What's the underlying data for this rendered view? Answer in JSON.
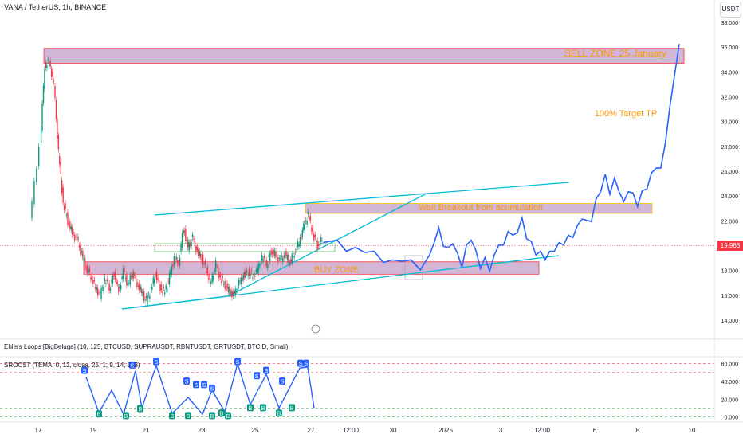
{
  "header": {
    "symbol_title": "VANA / TetherUS, 1h, BINANCE",
    "currency_button": "USDT"
  },
  "indicators": {
    "ehlers_label": "Ehlers Loops [BigBeluga] (10, 125, BTCUSD, SUPRAUSDT, RBNTUSDT, GRTUSDT, BTC.D, Small)",
    "srocst_label": "SROCST (TEMA, 0, 12, close, 25, 1, 9, 14, 1, 3)"
  },
  "current_price": "19.986",
  "colors": {
    "up": "#089981",
    "down": "#f23645",
    "projection": "#2962ff",
    "zone_fill": "#7b2d86",
    "annotation": "#ff9800",
    "trendline": "#00bcd4",
    "price_line": "#f23645"
  },
  "chart_data": [
    {
      "type": "candlestick",
      "title": "VANA / TetherUS, 1h, BINANCE",
      "y_axis_ticks": [
        "14.000",
        "16.000",
        "18.000",
        "20.000",
        "22.000",
        "24.000",
        "26.000",
        "28.000",
        "30.000",
        "32.000",
        "34.000",
        "36.000",
        "38.000"
      ],
      "x_axis_ticks": [
        "17",
        "19",
        "21",
        "23",
        "25",
        "27",
        "12:00",
        "30",
        "2025",
        "3",
        "12:00",
        "6",
        "8",
        "10"
      ],
      "ylim": [
        13.0,
        38.5
      ],
      "price_path": [
        [
          0,
          22.0
        ],
        [
          2,
          28.0
        ],
        [
          3,
          34.5
        ],
        [
          4,
          34.8
        ],
        [
          5,
          33.0
        ],
        [
          6,
          27.5
        ],
        [
          7,
          23.5
        ],
        [
          8,
          22.0
        ],
        [
          9,
          21.0
        ],
        [
          10,
          20.5
        ],
        [
          11,
          19.3
        ],
        [
          12,
          18.2
        ],
        [
          13,
          17.6
        ],
        [
          14,
          16.6
        ],
        [
          15,
          16.0
        ],
        [
          16,
          17.2
        ],
        [
          17,
          16.5
        ],
        [
          18,
          17.8
        ],
        [
          19,
          16.3
        ],
        [
          20,
          17.9
        ],
        [
          21,
          16.8
        ],
        [
          22,
          17.9
        ],
        [
          23,
          17.0
        ],
        [
          24,
          16.2
        ],
        [
          25,
          15.5
        ],
        [
          26,
          16.5
        ],
        [
          27,
          17.8
        ],
        [
          28,
          16.6
        ],
        [
          29,
          16.2
        ],
        [
          30,
          17.5
        ],
        [
          31,
          19.0
        ],
        [
          32,
          18.6
        ],
        [
          33,
          21.5
        ],
        [
          34,
          19.8
        ],
        [
          35,
          20.6
        ],
        [
          36,
          19.5
        ],
        [
          37,
          19.0
        ],
        [
          38,
          18.0
        ],
        [
          39,
          17.0
        ],
        [
          40,
          18.5
        ],
        [
          41,
          17.4
        ],
        [
          42,
          16.8
        ],
        [
          43,
          16.3
        ],
        [
          44,
          16.0
        ],
        [
          45,
          16.9
        ],
        [
          46,
          17.6
        ],
        [
          47,
          17.9
        ],
        [
          48,
          17.6
        ],
        [
          49,
          18.0
        ],
        [
          50,
          19.0
        ],
        [
          51,
          18.5
        ],
        [
          52,
          19.6
        ],
        [
          53,
          19.2
        ],
        [
          54,
          18.8
        ],
        [
          55,
          19.3
        ],
        [
          56,
          18.7
        ],
        [
          57,
          19.5
        ],
        [
          58,
          20.2
        ],
        [
          59,
          21.5
        ],
        [
          60,
          22.5
        ],
        [
          61,
          21.0
        ],
        [
          62,
          20.0
        ],
        [
          63,
          20.5
        ]
      ],
      "projection_path": [
        [
          63,
          20.5
        ],
        [
          66,
          20.2
        ],
        [
          68,
          19.8
        ],
        [
          70,
          19.6
        ],
        [
          72,
          19.7
        ],
        [
          74,
          19.3
        ],
        [
          76,
          18.9
        ],
        [
          78,
          18.6
        ],
        [
          80,
          19.0
        ],
        [
          82,
          18.6
        ],
        [
          84,
          18.3
        ],
        [
          86,
          19.0
        ],
        [
          87,
          20.5
        ],
        [
          88,
          21.2
        ],
        [
          89,
          20.2
        ],
        [
          90,
          19.6
        ],
        [
          91,
          20.4
        ],
        [
          92,
          19.2
        ],
        [
          93,
          18.5
        ],
        [
          94,
          19.8
        ],
        [
          95,
          20.7
        ],
        [
          96,
          19.4
        ],
        [
          97,
          18.4
        ],
        [
          98,
          18.8
        ],
        [
          99,
          18.2
        ],
        [
          100,
          19.0
        ],
        [
          101,
          20.3
        ],
        [
          102,
          19.8
        ],
        [
          103,
          21.4
        ],
        [
          104,
          20.6
        ],
        [
          105,
          21.3
        ],
        [
          106,
          22.0
        ],
        [
          107,
          20.8
        ],
        [
          108,
          20.1
        ],
        [
          109,
          19.5
        ],
        [
          110,
          19.3
        ],
        [
          111,
          19.1
        ],
        [
          112,
          19.3
        ],
        [
          113,
          19.8
        ],
        [
          114,
          20.0
        ],
        [
          115,
          20.3
        ],
        [
          116,
          20.6
        ],
        [
          117,
          20.9
        ],
        [
          118,
          21.4
        ],
        [
          119,
          22.4
        ],
        [
          120,
          21.8
        ],
        [
          121,
          22.2
        ],
        [
          122,
          23.5
        ],
        [
          123,
          24.6
        ],
        [
          124,
          25.5
        ],
        [
          125,
          24.4
        ],
        [
          126,
          25.2
        ],
        [
          127,
          24.6
        ],
        [
          128,
          23.3
        ],
        [
          129,
          24.6
        ],
        [
          130,
          24.0
        ],
        [
          131,
          23.4
        ],
        [
          132,
          24.2
        ],
        [
          133,
          24.8
        ],
        [
          134,
          25.6
        ],
        [
          135,
          26.5
        ],
        [
          136,
          26.0
        ],
        [
          137,
          28.5
        ],
        [
          138,
          31.0
        ],
        [
          139,
          34.0
        ],
        [
          140,
          36.0
        ]
      ],
      "zones": [
        {
          "label": "SELL ZONE 25 January",
          "y_low": 34.7,
          "y_high": 35.9
        },
        {
          "label": "Wait Breakout from acumulation",
          "y_low": 22.6,
          "y_high": 23.4
        },
        {
          "label": "BUY ZONE",
          "y_low": 17.7,
          "y_high": 18.7
        }
      ],
      "annotations": [
        "100% Target TP"
      ],
      "current_price": 19.986
    },
    {
      "type": "line",
      "title": "SROCST (TEMA, 0, 12, close, 25, 1, 9, 14, 1, 3)",
      "y_axis_ticks": [
        "0.000",
        "20.000",
        "40.000",
        "60.000"
      ],
      "ylim": [
        -4,
        66
      ],
      "signals_sell_label": "S",
      "signals_buy_label": "B"
    }
  ]
}
